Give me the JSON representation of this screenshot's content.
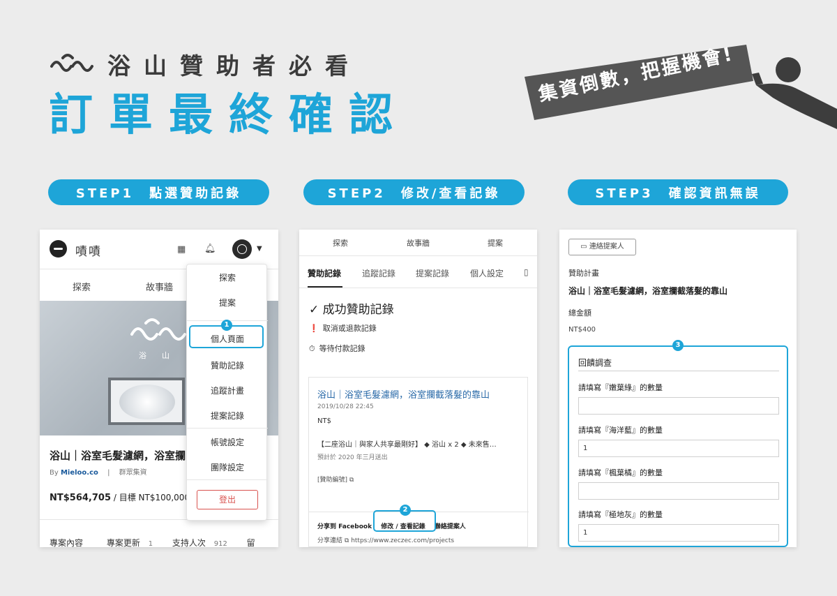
{
  "header": {
    "brand": "浴山贊助者必看",
    "title": "訂單最終確認",
    "banner": "集資倒數，把握機會!"
  },
  "steps": [
    {
      "label": "STEP1　點選贊助記錄"
    },
    {
      "label": "STEP2　修改/查看記錄"
    },
    {
      "label": "STEP3　確認資訊無誤"
    }
  ],
  "panel1": {
    "site_name": "嘖嘖",
    "nav": [
      "探索",
      "故事牆"
    ],
    "hero_brand": "浴山",
    "project_title": "浴山｜浴室毛髮濾網，浴室攔",
    "by_prefix": "By",
    "by_name": "Mieloo.co",
    "by_type": "群眾集資",
    "amount": "NT$564,705",
    "goal": "/ 目標 NT$100,000",
    "bottom": {
      "content": "專案內容",
      "updates": "專案更新",
      "updates_count": "1",
      "backers": "支持人次",
      "backers_count": "912",
      "more": "留"
    },
    "dropdown": {
      "items": [
        "探索",
        "提案",
        "個人頁面",
        "贊助記錄",
        "追蹤計畫",
        "提案記錄",
        "帳號設定",
        "團隊設定"
      ],
      "logout": "登出"
    },
    "marker": "1"
  },
  "panel2": {
    "nav": [
      "探索",
      "故事牆",
      "提案"
    ],
    "tabs": [
      "贊助記錄",
      "追蹤記錄",
      "提案記錄",
      "個人設定"
    ],
    "heading": "✓ 成功贊助記錄",
    "links": [
      "取消或退款記錄",
      "等待付款記錄"
    ],
    "card": {
      "title": "浴山｜浴室毛髮濾網，浴室攔截落髮的靠山",
      "date": "2019/10/28 22:45",
      "currency": "NT$",
      "desc": "【二座浴山｜與家人共享最剛好】 ◆ 浴山 x 2 ◆ 未來售…",
      "ship": "預計於 2020 年三月送出",
      "id_label": "[贊助編號]",
      "share_fb": "分享到 Facebook",
      "edit": "修改 / 查看記錄",
      "contact": "聯絡提案人",
      "share_link_label": "分享連結",
      "share_url": "https://www.zeczec.com/projects"
    },
    "marker": "2"
  },
  "panel3": {
    "contact_button": "連絡提案人",
    "plan_label": "贊助計畫",
    "plan_value": "浴山｜浴室毛髮濾網，浴室攔截落髮的靠山",
    "total_label": "總金額",
    "total_value": "NT$400",
    "survey_title": "回饋調查",
    "questions": [
      {
        "label": "請填寫『嫩葉綠』的數量",
        "value": ""
      },
      {
        "label": "請填寫『海洋藍』的數量",
        "value": "1"
      },
      {
        "label": "請填寫『楓葉橘』的數量",
        "value": ""
      },
      {
        "label": "請填寫『極地灰』的數量",
        "value": "1"
      }
    ],
    "marker": "3"
  },
  "colors": {
    "accent": "#1ea5d8",
    "banner": "#555555",
    "logout": "#d9534f",
    "link": "#2a6aa8"
  }
}
